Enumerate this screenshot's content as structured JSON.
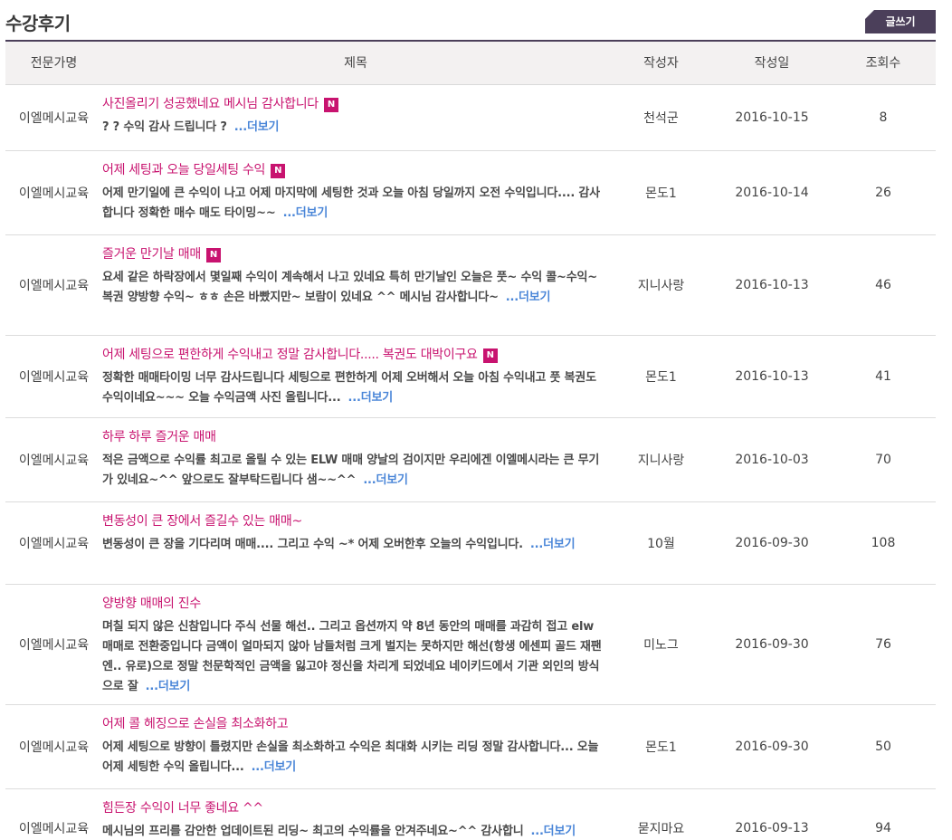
{
  "board": {
    "title": "수강후기",
    "write_label": "글쓰기",
    "columns": [
      "전문가명",
      "제목",
      "작성자",
      "작성일",
      "조회수"
    ],
    "more_label": "...더보기",
    "new_badge": "N",
    "accent_color": "#c8136f",
    "link_color": "#4a86d8",
    "header_color": "#4b3f5a",
    "rows": [
      {
        "expert": "이엘메시교육",
        "title": "사진올리기 성공했네요 메시님 감사합니다",
        "is_new": true,
        "summary": "? ? 수익 감사 드립니다 ?",
        "author": "천석군",
        "date": "2016-10-15",
        "views": "8"
      },
      {
        "expert": "이엘메시교육",
        "title": "어제 세팅과 오늘 당일세팅 수익",
        "is_new": true,
        "summary": "어제 만기일에 큰 수익이 나고 어제 마지막에 세팅한 것과 오늘 아침 당일까지 오전 수익입니다.... 감사합니다 정확한 매수 매도 타이밍~~",
        "author": "몬도1",
        "date": "2016-10-14",
        "views": "26"
      },
      {
        "expert": "이엘메시교육",
        "title": "즐거운 만기날 매매",
        "is_new": true,
        "summary": "요세 같은 하락장에서 몇일째 수익이 계속해서 나고 있네요 특히 만기날인 오늘은 풋~ 수익 콜~수익~복권 양방향 수익~ ㅎㅎ 손은 바빴지만~ 보람이 있네요 ^^ 메시님 감사합니다~",
        "author": "지니사랑",
        "date": "2016-10-13",
        "views": "46"
      },
      {
        "expert": "이엘메시교육",
        "title": "어제 세팅으로 편한하게 수익내고 정말 감사합니다..... 복권도 대박이구요",
        "is_new": true,
        "summary": "정확한 매매타이밍 너무 감사드립니다 세팅으로 편한하게 어제 오버해서 오늘 아침 수익내고 풋 복권도 수익이네요~~~ 오늘 수익금액 사진 올립니다...",
        "author": "몬도1",
        "date": "2016-10-13",
        "views": "41"
      },
      {
        "expert": "이엘메시교육",
        "title": "하루 하루 즐거운 매매",
        "is_new": false,
        "summary": "적은 금액으로 수익률 최고로 올릴 수 있는 ELW 매매 양날의 검이지만 우리에겐 이엘메시라는 큰 무기가 있네요~^^ 앞으로도 잘부탁드립니다 샘~~^^",
        "author": "지니사랑",
        "date": "2016-10-03",
        "views": "70"
      },
      {
        "expert": "이엘메시교육",
        "title": "변동성이 큰 장에서 즐길수 있는 매매~",
        "is_new": false,
        "summary": "변동성이 큰 장을 기다리며 매매.... 그리고 수익 ~* 어제 오버한후 오늘의 수익입니다.",
        "author": "10월",
        "date": "2016-09-30",
        "views": "108"
      },
      {
        "expert": "이엘메시교육",
        "title": "양방향 매매의 진수",
        "is_new": false,
        "summary": "며칠 되지 않은 신참입니다 주식 선물 해선.. 그리고 옵션까지 약 8년 동안의 매매를 과감히 접고 elw매매로 전환중입니다 금액이 얼마되지 않아 남들처럼 크게 벌지는 못하지만 해선(항생 에센피 골드 재팬엔.. 유로)으로 정말 천문학적인 금액을 잃고야 정신을 차리게 되었네요 네이키드에서 기관 외인의 방식으로 잘",
        "author": "미노그",
        "date": "2016-09-30",
        "views": "76"
      },
      {
        "expert": "이엘메시교육",
        "title": "어제 콜 헤징으로 손실을 최소화하고",
        "is_new": false,
        "summary": "어제 세팅으로 방향이 틀렸지만 손실을 최소화하고 수익은 최대화 시키는 리딩 정말 감사합니다... 오늘 어제 세팅한 수익 올립니다...",
        "author": "몬도1",
        "date": "2016-09-30",
        "views": "50"
      },
      {
        "expert": "이엘메시교육",
        "title": "힘든장 수익이 너무 좋네요 ^^",
        "is_new": false,
        "summary": "메시님의 프리를 감안한 업데이트된 리딩~ 최고의 수익률을 안겨주네요~^^ 감사합니",
        "author": "묻지마요",
        "date": "2016-09-13",
        "views": "94"
      }
    ]
  }
}
